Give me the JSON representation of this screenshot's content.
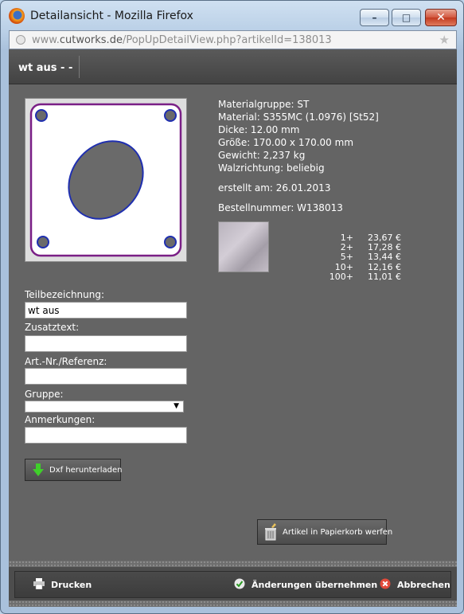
{
  "window": {
    "title": "Detailansicht - Mozilla Firefox",
    "minimize_label": "–",
    "maximize_label": "□",
    "close_label": "✕"
  },
  "urlbar": {
    "prefix": "www.",
    "domain": "cutworks.de",
    "path": "/PopUpDetailView.php?artikelId=138013"
  },
  "header": {
    "title": "wt aus - -"
  },
  "part": {
    "outline_color": "#7a1f86",
    "hole_color": "#1f2fb0",
    "fill_color": "#ffffff",
    "hole_fill": "#6a6a6a"
  },
  "info": {
    "materialgruppe": "Materialgruppe: ST",
    "material": "Material: S355MC (1.0976) [St52]",
    "dicke": "Dicke: 12.00 mm",
    "groesse": "Größe: 170.00 x 170.00 mm",
    "gewicht": "Gewicht: 2,237 kg",
    "walzrichtung": "Walzrichtung: beliebig",
    "erstellt": "erstellt am: 26.01.2013",
    "bestellnummer": "Bestellnummer: W138013"
  },
  "prices": [
    {
      "qty": "1+",
      "price": "23,67 €"
    },
    {
      "qty": "2+",
      "price": "17,28 €"
    },
    {
      "qty": "5+",
      "price": "13,44 €"
    },
    {
      "qty": "10+",
      "price": "12,16 €"
    },
    {
      "qty": "100+",
      "price": "11,01 €"
    }
  ],
  "form": {
    "teilbezeichnung_label": "Teilbezeichnung:",
    "teilbezeichnung_value": "wt aus",
    "zusatztext_label": "Zusatztext:",
    "zusatztext_value": "",
    "artnr_label": "Art.-Nr./Referenz:",
    "artnr_value": "",
    "gruppe_label": "Gruppe:",
    "gruppe_value": "",
    "anmerkungen_label": "Anmerkungen:",
    "anmerkungen_value": ""
  },
  "buttons": {
    "dxf": "Dxf herunterladen",
    "basket": "Artikel in Papierkorb werfen",
    "print": "Drucken",
    "apply": "Änderungen übernehmen",
    "cancel": "Abbrechen"
  }
}
